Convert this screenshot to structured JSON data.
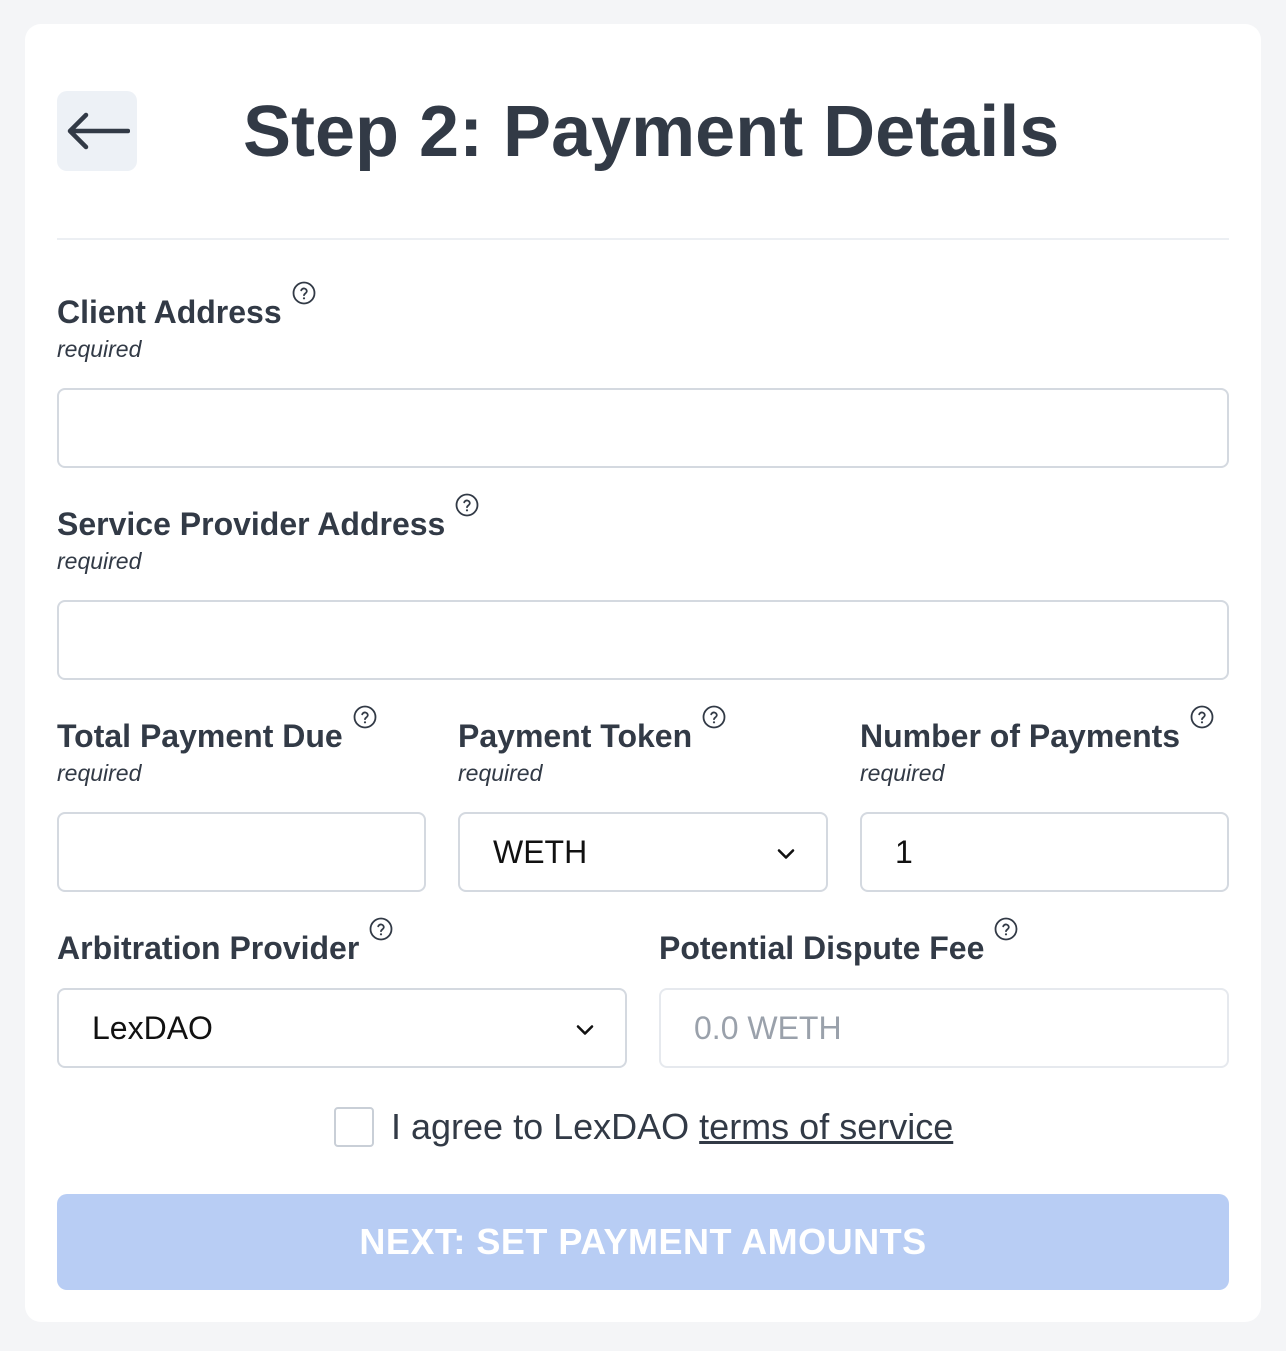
{
  "header": {
    "back_icon": "arrow-left-icon",
    "title": "Step 2: Payment Details"
  },
  "fields": {
    "client_address": {
      "label": "Client Address",
      "hint": "required",
      "value": ""
    },
    "provider_address": {
      "label": "Service Provider Address",
      "hint": "required",
      "value": ""
    },
    "total_payment": {
      "label": "Total Payment Due",
      "hint": "required",
      "value": ""
    },
    "payment_token": {
      "label": "Payment Token",
      "hint": "required",
      "value": "WETH"
    },
    "num_payments": {
      "label": "Number of Payments",
      "hint": "required",
      "value": "1"
    },
    "arbitration": {
      "label": "Arbitration Provider",
      "value": "LexDAO"
    },
    "dispute_fee": {
      "label": "Potential Dispute Fee",
      "value": "0.0 WETH"
    }
  },
  "agreement": {
    "text": "I agree to LexDAO ",
    "link": "terms of service",
    "checked": false
  },
  "next_button": {
    "label": "NEXT: SET PAYMENT AMOUNTS"
  },
  "colors": {
    "title": "#323a46",
    "button_disabled": "#b8cdf4",
    "background": "#f4f5f7"
  }
}
